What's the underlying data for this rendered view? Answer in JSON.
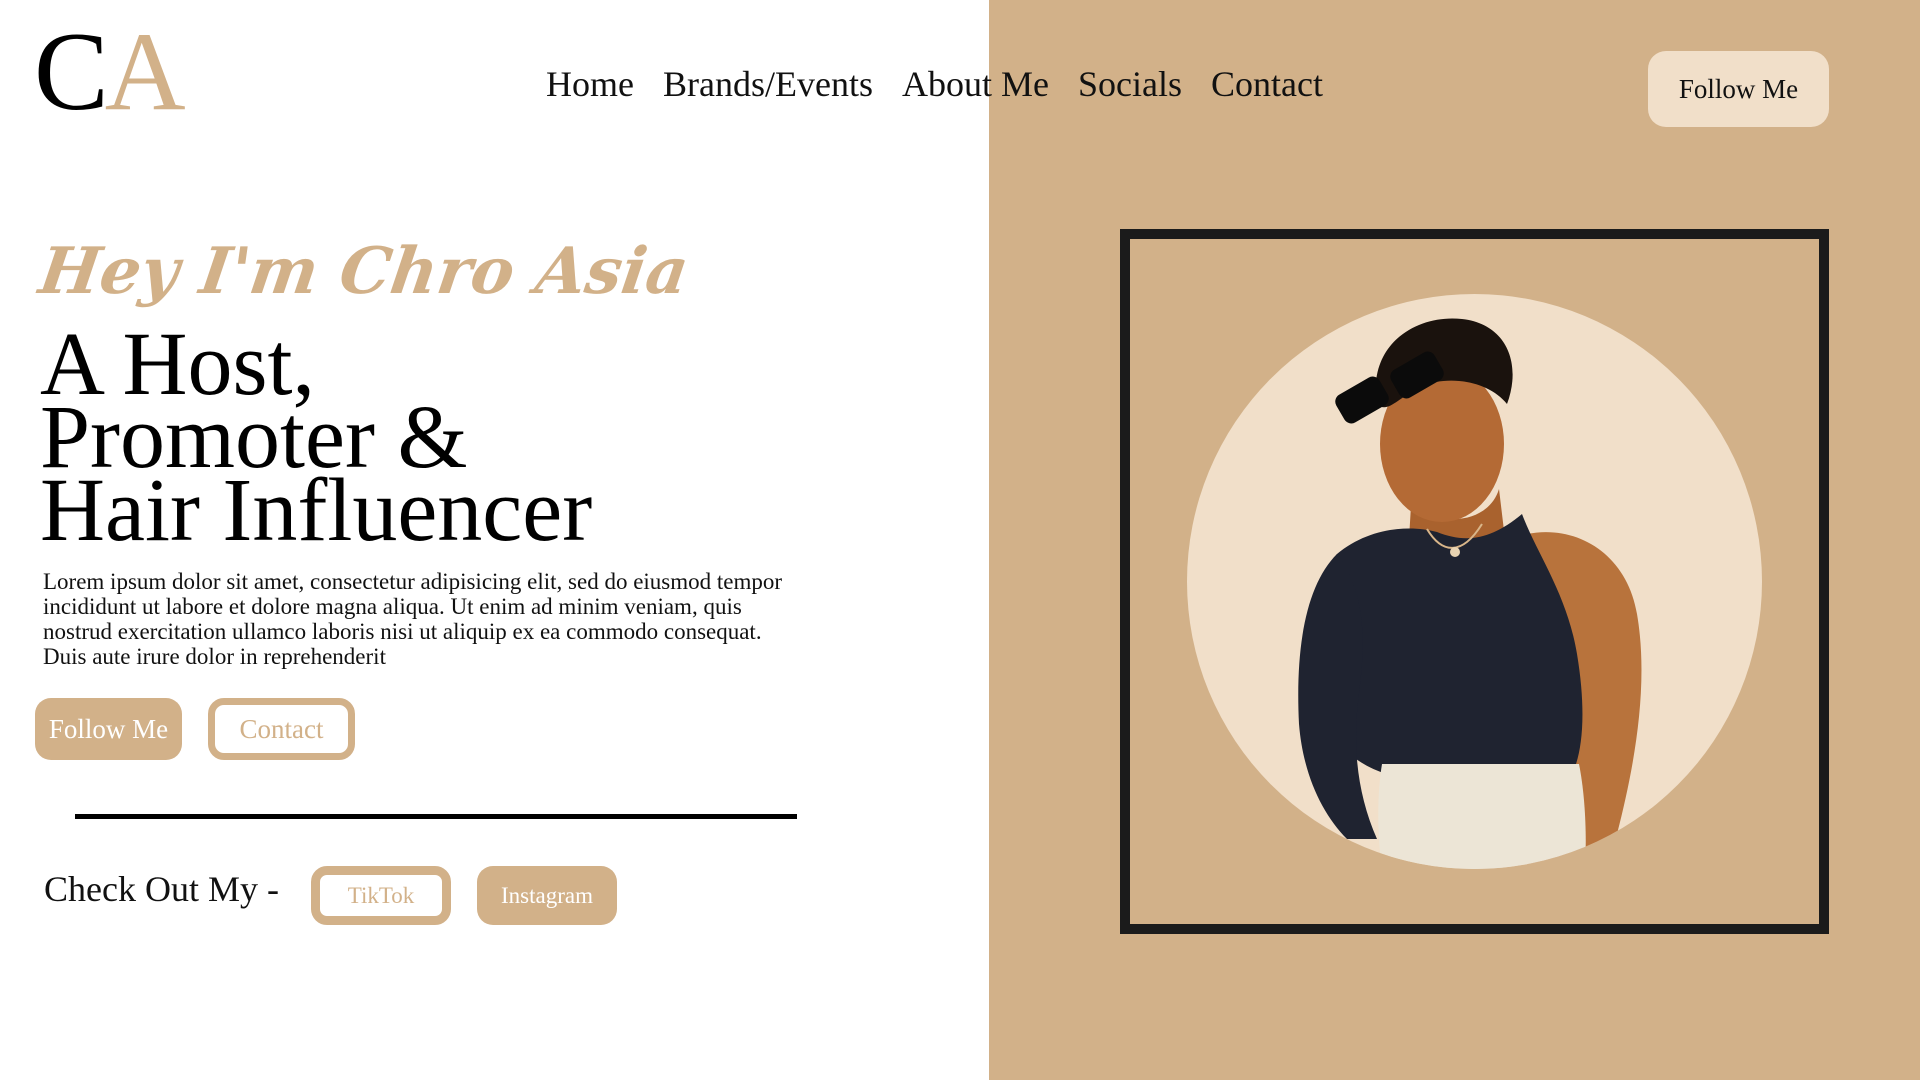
{
  "colors": {
    "tan": "#d2b189",
    "cream": "#f1dfc9",
    "dark": "#1b1b1b",
    "white": "#ffffff"
  },
  "logo": {
    "first_letter": "C",
    "second_letter": "A"
  },
  "nav": {
    "items": [
      "Home",
      "Brands/Events",
      "About Me",
      "Socials",
      "Contact"
    ]
  },
  "header": {
    "follow_label": "Follow Me"
  },
  "hero": {
    "greeting": "Hey I'm Chro Asia",
    "headline_lines": [
      "A Host,",
      "Promoter &",
      "Hair Influencer"
    ],
    "bio": "Lorem ipsum dolor sit amet, consectetur adipisicing elit, sed do eiusmod tempor incididunt ut labore et dolore magna aliqua. Ut enim ad minim veniam, quis nostrud exercitation ullamco laboris nisi ut aliquip ex ea commodo consequat. Duis aute irure dolor in reprehenderit",
    "follow_label": "Follow Me",
    "contact_label": "Contact"
  },
  "socials": {
    "label": "Check Out My -",
    "tiktok_label": "TikTok",
    "instagram_label": "Instagram"
  },
  "portrait": {
    "icon": "person-portrait-icon"
  }
}
